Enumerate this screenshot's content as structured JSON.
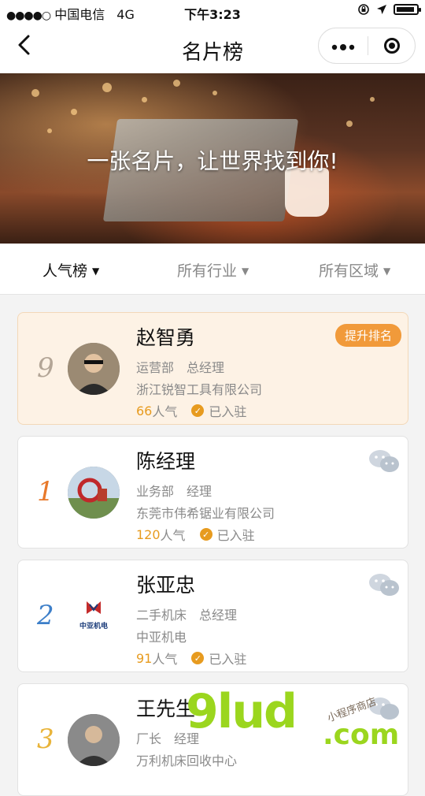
{
  "status_bar": {
    "signal": "●●●●○",
    "carrier": "中国电信",
    "network": "4G",
    "time": "下午3:23"
  },
  "nav": {
    "title": "名片榜"
  },
  "banner": {
    "slogan": "一张名片，让世界找到你!"
  },
  "filters": [
    {
      "label": "人气榜",
      "active": true
    },
    {
      "label": "所有行业",
      "active": false
    },
    {
      "label": "所有区域",
      "active": false
    }
  ],
  "cards": [
    {
      "rank": "9",
      "rank_color": "#b3a596",
      "name": "赵智勇",
      "department": "运营部",
      "title": "总经理",
      "company": "浙江锐智工具有限公司",
      "popularity": "66",
      "popularity_suffix": "人气",
      "status": "已入驻",
      "action_label": "提升排名"
    },
    {
      "rank": "1",
      "rank_color": "#e8792b",
      "name": "陈经理",
      "department": "业务部",
      "title": "经理",
      "company": "东莞市伟希锯业有限公司",
      "popularity": "120",
      "popularity_suffix": "人气",
      "status": "已入驻"
    },
    {
      "rank": "2",
      "rank_color": "#3d7fc9",
      "name": "张亚忠",
      "department": "二手机床",
      "title": "总经理",
      "company": "中亚机电",
      "popularity": "91",
      "popularity_suffix": "人气",
      "status": "已入驻",
      "logo_text": "中亚机电"
    },
    {
      "rank": "3",
      "rank_color": "#e9b43a",
      "name": "王先生",
      "department": "厂长",
      "title": "经理",
      "company": "万利机床回收中心"
    }
  ],
  "watermark": {
    "main": "9lud",
    "domain": ".com",
    "tagline": "小程序商店"
  },
  "colors": {
    "accent": "#e79b1f",
    "boost_button": "#f19a3a",
    "highlight_card": "#fdf2e5"
  }
}
